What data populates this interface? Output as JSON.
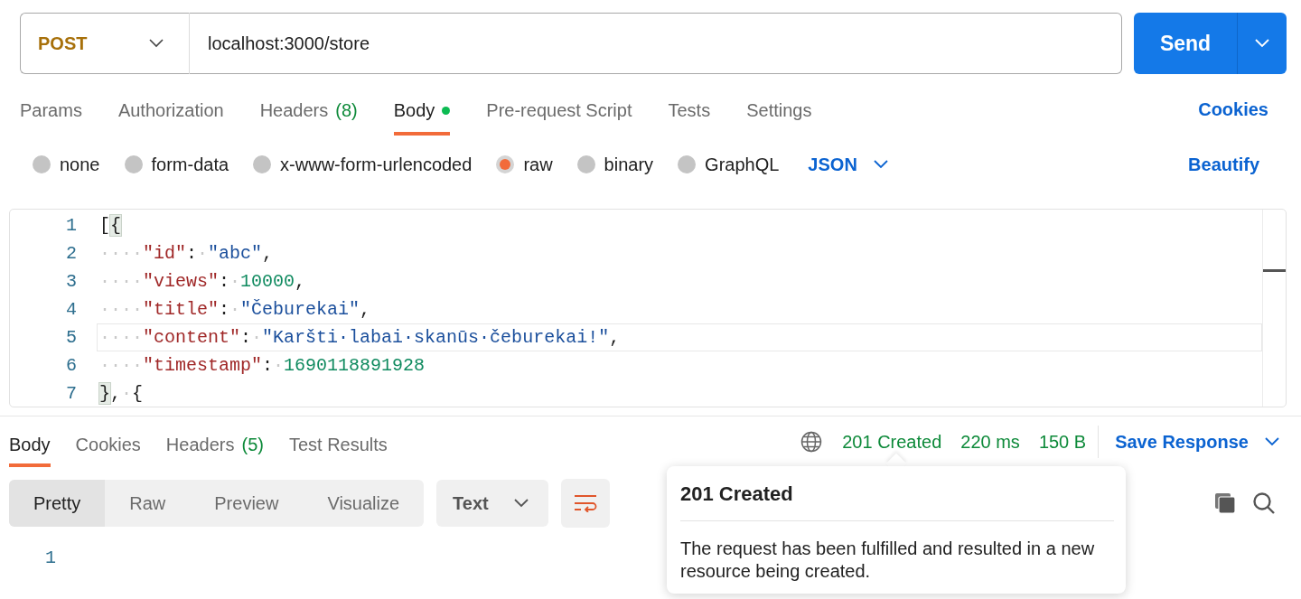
{
  "request": {
    "method": "POST",
    "url": "localhost:3000/store",
    "send": "Send"
  },
  "request_tabs": [
    {
      "label": "Params",
      "selected": false,
      "dot": false
    },
    {
      "label": "Authorization",
      "selected": false,
      "dot": false
    },
    {
      "label": "Headers",
      "count": "(8)",
      "selected": false,
      "dot": false
    },
    {
      "label": "Body",
      "selected": true,
      "dot": true
    },
    {
      "label": "Pre-request Script",
      "selected": false,
      "dot": false
    },
    {
      "label": "Tests",
      "selected": false,
      "dot": false
    },
    {
      "label": "Settings",
      "selected": false,
      "dot": false
    }
  ],
  "cookies_link": "Cookies",
  "body_modes": [
    {
      "label": "none",
      "selected": false
    },
    {
      "label": "form-data",
      "selected": false
    },
    {
      "label": "x-www-form-urlencoded",
      "selected": false
    },
    {
      "label": "raw",
      "selected": true
    },
    {
      "label": "binary",
      "selected": false
    },
    {
      "label": "GraphQL",
      "selected": false
    }
  ],
  "raw_format": "JSON",
  "beautify": "Beautify",
  "editor": {
    "lines": [
      {
        "number": "1",
        "active": false,
        "tokens": [
          {
            "kind": "punct",
            "text": "["
          },
          {
            "kind": "match",
            "text": "{"
          }
        ]
      },
      {
        "number": "2",
        "active": false,
        "tokens": [
          {
            "kind": "ws",
            "text": "····"
          },
          {
            "kind": "key",
            "text": "\"id\""
          },
          {
            "kind": "punct",
            "text": ":"
          },
          {
            "kind": "ws",
            "text": "·"
          },
          {
            "kind": "string",
            "text": "\"abc\""
          },
          {
            "kind": "punct",
            "text": ","
          }
        ]
      },
      {
        "number": "3",
        "active": false,
        "tokens": [
          {
            "kind": "ws",
            "text": "····"
          },
          {
            "kind": "key",
            "text": "\"views\""
          },
          {
            "kind": "punct",
            "text": ":"
          },
          {
            "kind": "ws",
            "text": "·"
          },
          {
            "kind": "number",
            "text": "10000"
          },
          {
            "kind": "punct",
            "text": ","
          }
        ]
      },
      {
        "number": "4",
        "active": false,
        "tokens": [
          {
            "kind": "ws",
            "text": "····"
          },
          {
            "kind": "key",
            "text": "\"title\""
          },
          {
            "kind": "punct",
            "text": ":"
          },
          {
            "kind": "ws",
            "text": "·"
          },
          {
            "kind": "string",
            "text": "\"Čeburekai\""
          },
          {
            "kind": "punct",
            "text": ","
          }
        ]
      },
      {
        "number": "5",
        "active": true,
        "tokens": [
          {
            "kind": "ws",
            "text": "····"
          },
          {
            "kind": "key",
            "text": "\"content\""
          },
          {
            "kind": "punct",
            "text": ":"
          },
          {
            "kind": "ws",
            "text": "·"
          },
          {
            "kind": "string",
            "text": "\"Karšti·labai·skanūs·čeburekai!\""
          },
          {
            "kind": "punct",
            "text": ","
          }
        ]
      },
      {
        "number": "6",
        "active": false,
        "tokens": [
          {
            "kind": "ws",
            "text": "····"
          },
          {
            "kind": "key",
            "text": "\"timestamp\""
          },
          {
            "kind": "punct",
            "text": ":"
          },
          {
            "kind": "ws",
            "text": "·"
          },
          {
            "kind": "number",
            "text": "1690118891928"
          }
        ]
      },
      {
        "number": "7",
        "active": false,
        "tokens": [
          {
            "kind": "match",
            "text": "}"
          },
          {
            "kind": "punct",
            "text": ","
          },
          {
            "kind": "ws",
            "text": "·"
          },
          {
            "kind": "punct",
            "text": "{"
          }
        ]
      }
    ]
  },
  "response_tabs": [
    {
      "label": "Body",
      "selected": true
    },
    {
      "label": "Cookies",
      "selected": false
    },
    {
      "label": "Headers",
      "count": "(5)",
      "selected": false
    },
    {
      "label": "Test Results",
      "selected": false
    }
  ],
  "response_status": {
    "status": "201 Created",
    "time": "220 ms",
    "size": "150 B"
  },
  "save_response": "Save Response",
  "view_modes": [
    {
      "label": "Pretty",
      "selected": true
    },
    {
      "label": "Raw",
      "selected": false
    },
    {
      "label": "Preview",
      "selected": false
    },
    {
      "label": "Visualize",
      "selected": false
    }
  ],
  "response_format": "Text",
  "response_lines": [
    {
      "number": "1"
    }
  ],
  "tooltip": {
    "title": "201 Created",
    "text": "The request has been fulfilled and resulted in a new resource being created."
  }
}
